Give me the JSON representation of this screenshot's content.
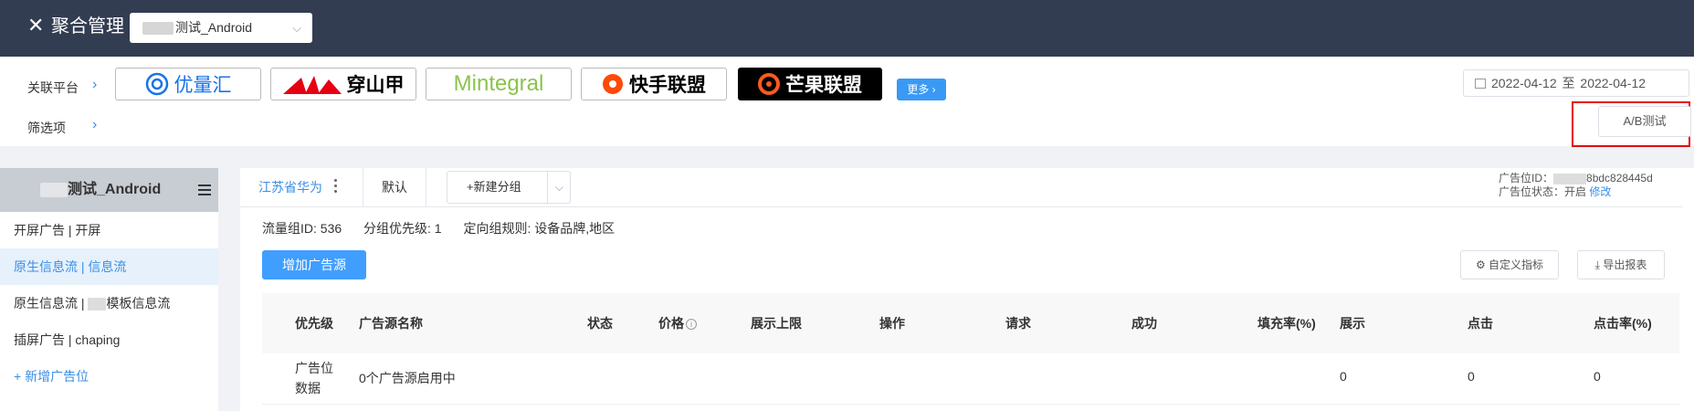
{
  "header": {
    "close_icon": "✕",
    "title": "聚合管理",
    "app_select_value": "测试_Android"
  },
  "platform": {
    "label": "关联平台",
    "filter_label": "筛选项",
    "logos": [
      "优量汇",
      "穿山甲",
      "Mintegral",
      "快手联盟",
      "芒果联盟"
    ],
    "more_label": "更多 ›",
    "date_start": "2022-04-12",
    "date_sep": "至",
    "date_end": "2022-04-12",
    "ab_test_label": "A/B测试"
  },
  "sidebar": {
    "app_name": "测试_Android",
    "items": [
      {
        "label": "开屏广告 | 开屏"
      },
      {
        "label": "原生信息流 | 信息流"
      },
      {
        "label_prefix": "原生信息流 | ",
        "label_suffix": "模板信息流"
      },
      {
        "label": "插屏广告 | chaping"
      }
    ],
    "add_label": "+ 新增广告位"
  },
  "main": {
    "tabs": {
      "active": "江苏省华为",
      "default": "默认",
      "new_group": "+新建分组"
    },
    "adinfo": {
      "id_label": "广告位ID：",
      "id_suffix": "8bdc828445d",
      "status_label": "广告位状态：",
      "status_value": "开启",
      "edit_link": "修改"
    },
    "meta": {
      "flow_id": "流量组ID: 536",
      "priority": "分组优先级: 1",
      "rules": "定向组规则: 设备品牌,地区"
    },
    "add_source_label": "增加广告源",
    "custom_metric_label": "自定义指标",
    "export_label": "导出报表",
    "table": {
      "headers": [
        "优先级",
        "广告源名称",
        "状态",
        "价格",
        "展示上限",
        "操作",
        "请求",
        "成功",
        "填充率(%)",
        "展示",
        "点击",
        "点击率(%)"
      ],
      "row": {
        "priority_line1": "广告位",
        "priority_line2": "数据",
        "name": "0个广告源启用中",
        "impressions": "0",
        "clicks": "0",
        "ctr": "0"
      }
    }
  }
}
